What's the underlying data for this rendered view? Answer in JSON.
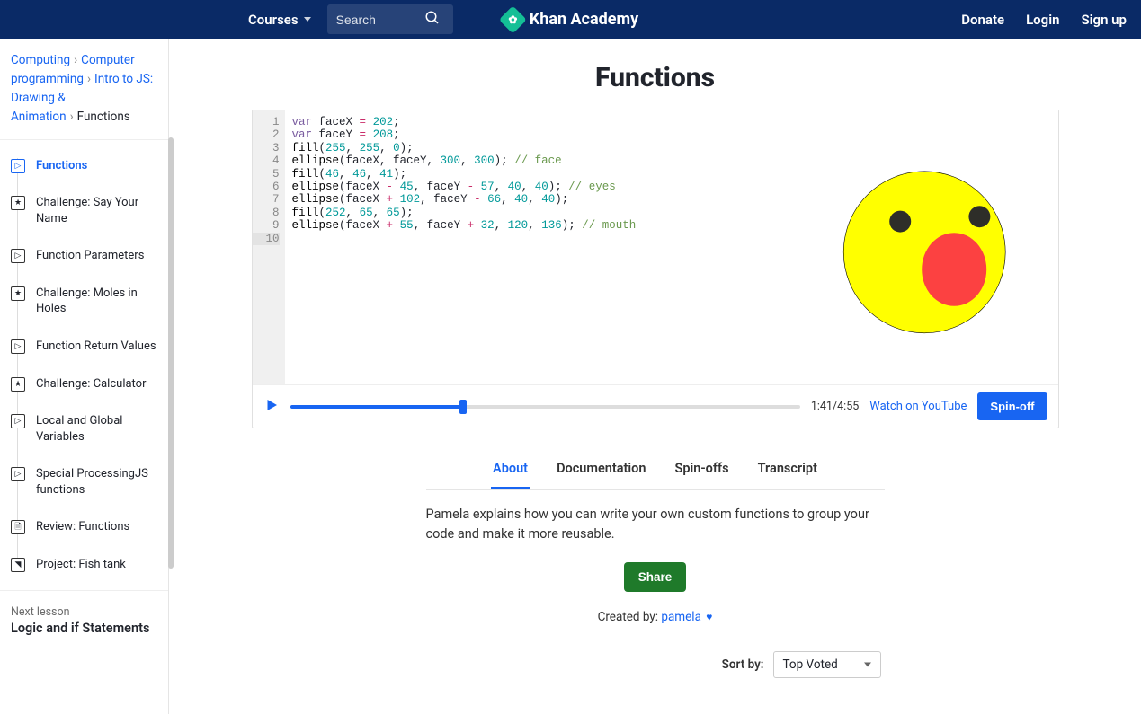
{
  "topbar": {
    "courses_label": "Courses",
    "search_placeholder": "Search",
    "brand_name": "Khan Academy",
    "links": {
      "donate": "Donate",
      "login": "Login",
      "signup": "Sign up"
    }
  },
  "breadcrumbs": {
    "items": [
      "Computing",
      "Computer programming",
      "Intro to JS: Drawing & Animation",
      "Functions"
    ]
  },
  "sidebar": {
    "items": [
      {
        "icon": "play",
        "label": "Functions",
        "active": true
      },
      {
        "icon": "star",
        "label": "Challenge: Say Your Name"
      },
      {
        "icon": "play",
        "label": "Function Parameters"
      },
      {
        "icon": "star",
        "label": "Challenge: Moles in Holes"
      },
      {
        "icon": "play",
        "label": "Function Return Values"
      },
      {
        "icon": "star",
        "label": "Challenge: Calculator"
      },
      {
        "icon": "play",
        "label": "Local and Global Variables"
      },
      {
        "icon": "play",
        "label": "Special ProcessingJS functions"
      },
      {
        "icon": "doc",
        "label": "Review: Functions"
      },
      {
        "icon": "proj",
        "label": "Project: Fish tank"
      }
    ],
    "next_lesson_label": "Next lesson",
    "next_lesson_title": "Logic and if Statements"
  },
  "page": {
    "title": "Functions"
  },
  "code": {
    "lines": [
      [
        [
          "kw",
          "var"
        ],
        [
          "txt",
          " faceX "
        ],
        [
          "op",
          "="
        ],
        [
          "txt",
          " "
        ],
        [
          "num",
          "202"
        ],
        [
          "txt",
          ";"
        ]
      ],
      [
        [
          "kw",
          "var"
        ],
        [
          "txt",
          " faceY "
        ],
        [
          "op",
          "="
        ],
        [
          "txt",
          " "
        ],
        [
          "num",
          "208"
        ],
        [
          "txt",
          ";"
        ]
      ],
      [
        [
          "fn",
          "fill"
        ],
        [
          "txt",
          "("
        ],
        [
          "num",
          "255"
        ],
        [
          "txt",
          ", "
        ],
        [
          "num",
          "255"
        ],
        [
          "txt",
          ", "
        ],
        [
          "num",
          "0"
        ],
        [
          "txt",
          ");"
        ]
      ],
      [
        [
          "fn",
          "ellipse"
        ],
        [
          "txt",
          "(faceX, faceY, "
        ],
        [
          "num",
          "300"
        ],
        [
          "txt",
          ", "
        ],
        [
          "num",
          "300"
        ],
        [
          "txt",
          "); "
        ],
        [
          "com",
          "// face"
        ]
      ],
      [
        [
          "fn",
          "fill"
        ],
        [
          "txt",
          "("
        ],
        [
          "num",
          "46"
        ],
        [
          "txt",
          ", "
        ],
        [
          "num",
          "46"
        ],
        [
          "txt",
          ", "
        ],
        [
          "num",
          "41"
        ],
        [
          "txt",
          ");"
        ]
      ],
      [
        [
          "fn",
          "ellipse"
        ],
        [
          "txt",
          "(faceX "
        ],
        [
          "op",
          "-"
        ],
        [
          "txt",
          " "
        ],
        [
          "num",
          "45"
        ],
        [
          "txt",
          ", faceY "
        ],
        [
          "op",
          "-"
        ],
        [
          "txt",
          " "
        ],
        [
          "num",
          "57"
        ],
        [
          "txt",
          ", "
        ],
        [
          "num",
          "40"
        ],
        [
          "txt",
          ", "
        ],
        [
          "num",
          "40"
        ],
        [
          "txt",
          "); "
        ],
        [
          "com",
          "// eyes"
        ]
      ],
      [
        [
          "fn",
          "ellipse"
        ],
        [
          "txt",
          "(faceX "
        ],
        [
          "op",
          "+"
        ],
        [
          "txt",
          " "
        ],
        [
          "num",
          "102"
        ],
        [
          "txt",
          ", faceY "
        ],
        [
          "op",
          "-"
        ],
        [
          "txt",
          " "
        ],
        [
          "num",
          "66"
        ],
        [
          "txt",
          ", "
        ],
        [
          "num",
          "40"
        ],
        [
          "txt",
          ", "
        ],
        [
          "num",
          "40"
        ],
        [
          "txt",
          ");"
        ]
      ],
      [
        [
          "fn",
          "fill"
        ],
        [
          "txt",
          "("
        ],
        [
          "num",
          "252"
        ],
        [
          "txt",
          ", "
        ],
        [
          "num",
          "65"
        ],
        [
          "txt",
          ", "
        ],
        [
          "num",
          "65"
        ],
        [
          "txt",
          ");"
        ]
      ],
      [
        [
          "fn",
          "ellipse"
        ],
        [
          "txt",
          "(faceX "
        ],
        [
          "op",
          "+"
        ],
        [
          "txt",
          " "
        ],
        [
          "num",
          "55"
        ],
        [
          "txt",
          ", faceY "
        ],
        [
          "op",
          "+"
        ],
        [
          "txt",
          " "
        ],
        [
          "num",
          "32"
        ],
        [
          "txt",
          ", "
        ],
        [
          "num",
          "120"
        ],
        [
          "txt",
          ", "
        ],
        [
          "num",
          "136"
        ],
        [
          "txt",
          "); "
        ],
        [
          "com",
          "// mouth"
        ]
      ]
    ],
    "line_count": 10
  },
  "player": {
    "current_time": "1:41",
    "total_time": "4:55",
    "progress_pct": 34,
    "youtube_label": "Watch on YouTube",
    "spinoff_label": "Spin-off"
  },
  "tabs": [
    {
      "label": "About",
      "active": true
    },
    {
      "label": "Documentation"
    },
    {
      "label": "Spin-offs"
    },
    {
      "label": "Transcript"
    }
  ],
  "about": {
    "text": "Pamela explains how you can write your own custom functions to group your code and make it more reusable.",
    "share_label": "Share",
    "created_by_label": "Created by:",
    "author": "pamela",
    "sort_label": "Sort by:",
    "sort_value": "Top Voted"
  }
}
